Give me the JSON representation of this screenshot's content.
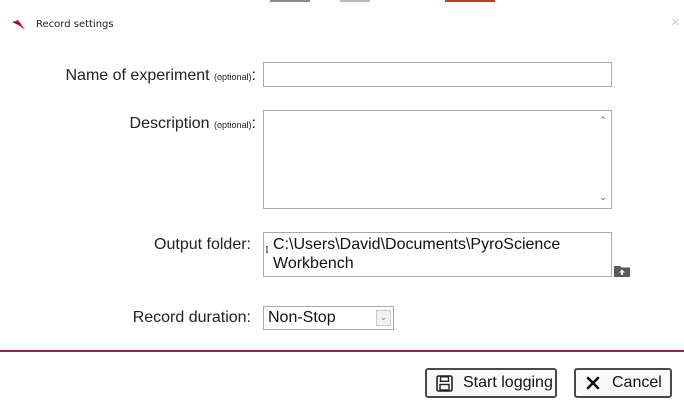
{
  "window": {
    "title": "Record settings",
    "app_icon": "pyroscience-logo-icon",
    "close_icon": "close-icon",
    "accent_color": "#a51d46"
  },
  "form": {
    "experiment_name": {
      "label": "Name of experiment",
      "optional_tag": "(optional)",
      "colon": ":",
      "value": ""
    },
    "description": {
      "label": "Description",
      "optional_tag": "(optional)",
      "colon": ":",
      "value": "",
      "scroll_up_icon": "chevron-up-icon",
      "scroll_down_icon": "chevron-down-icon"
    },
    "output_folder": {
      "label": "Output folder:",
      "value": "C:\\Users\\David\\Documents\\PyroScience Workbench",
      "browse_icon": "folder-upload-icon"
    },
    "record_duration": {
      "label": "Record duration:",
      "selected": "Non-Stop",
      "dropdown_icon": "chevron-down-icon"
    }
  },
  "buttons": {
    "start_logging": {
      "label": "Start logging",
      "icon": "save-icon"
    },
    "cancel": {
      "label": "Cancel",
      "icon": "x-icon"
    }
  }
}
